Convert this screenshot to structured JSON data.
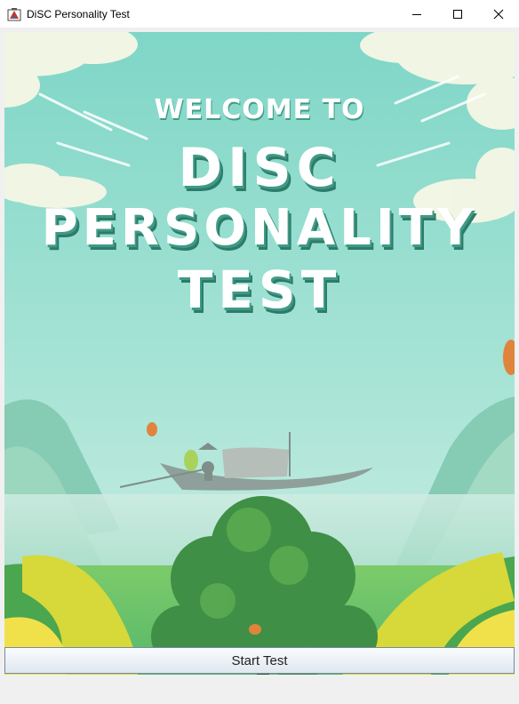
{
  "window": {
    "title": "DiSC Personality Test",
    "icon": "java-app-icon",
    "controls": [
      "minimize-icon",
      "maximize-icon",
      "close-icon"
    ]
  },
  "banner": {
    "line1": "WELCOME TO",
    "line2": "DISC",
    "line3": "PERSONALITY",
    "line4": "TEST"
  },
  "start": {
    "label": "Start Test"
  },
  "colors": {
    "sky_top": "#7fd6c7",
    "sky_bottom": "#c9ede2",
    "title_shadow": "#2d7b69",
    "tree": "#3f8f46",
    "foliage_yellow": "#d7d83a"
  }
}
